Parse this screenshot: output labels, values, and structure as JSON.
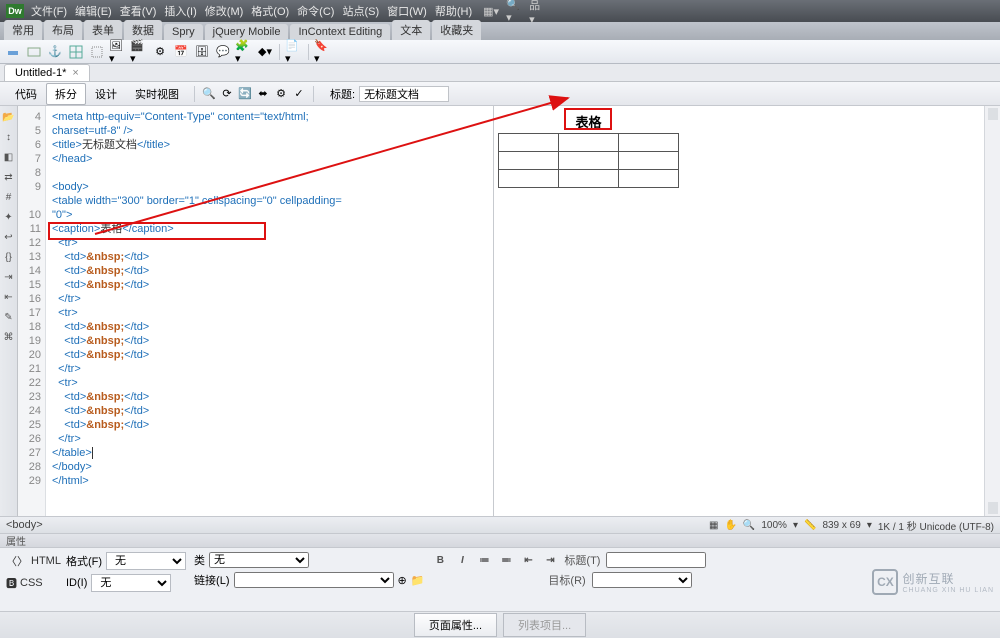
{
  "titlebar": {
    "logo": "Dw",
    "menus": [
      "文件(F)",
      "编辑(E)",
      "查看(V)",
      "插入(I)",
      "修改(M)",
      "格式(O)",
      "命令(C)",
      "站点(S)",
      "窗口(W)",
      "帮助(H)"
    ]
  },
  "category_tabs": [
    "常用",
    "布局",
    "表单",
    "数据",
    "Spry",
    "jQuery Mobile",
    "InContext Editing",
    "文本",
    "收藏夹"
  ],
  "doc_tab": {
    "name": "Untitled-1*"
  },
  "viewbar": {
    "buttons": [
      "代码",
      "拆分",
      "设计",
      "实时视图"
    ],
    "active": "拆分",
    "title_label": "标题:",
    "title_value": "无标题文档"
  },
  "gutter_lines": [
    "4",
    "5",
    "6",
    "7",
    "8",
    "9",
    "",
    "10",
    "11",
    "12",
    "13",
    "14",
    "15",
    "16",
    "17",
    "18",
    "19",
    "20",
    "21",
    "22",
    "23",
    "24",
    "25",
    "26",
    "27",
    "28",
    "29"
  ],
  "code_lines": [
    {
      "html": "<span class='tag'>&lt;meta</span> <span class='attr'>http-equiv=</span><span class='val'>\"Content-Type\"</span> <span class='attr'>content=</span><span class='val'>\"text/html;</span>"
    },
    {
      "html": "<span class='val'>charset=utf-8\"</span> <span class='tag'>/&gt;</span>"
    },
    {
      "html": "<span class='tag'>&lt;title&gt;</span><span class='text'>无标题文档</span><span class='tag'>&lt;/title&gt;</span>"
    },
    {
      "html": "<span class='tag'>&lt;/head&gt;</span>"
    },
    {
      "html": "&nbsp;"
    },
    {
      "html": "<span class='tag'>&lt;body&gt;</span>"
    },
    {
      "html": "<span class='tag'>&lt;table</span> <span class='attr'>width=</span><span class='val'>\"300\"</span> <span class='attr'>border=</span><span class='val'>\"1\"</span> <span class='attr'>cellspacing=</span><span class='val'>\"0\"</span> <span class='attr'>cellpadding=</span>"
    },
    {
      "html": "<span class='val'>\"0\"</span><span class='tag'>&gt;</span>"
    },
    {
      "html": "<span class='tag'>&lt;caption&gt;</span><span class='text'>表格</span><span class='tag'>&lt;/caption&gt;</span>"
    },
    {
      "html": "&nbsp;&nbsp;<span class='tag'>&lt;tr&gt;</span>"
    },
    {
      "html": "&nbsp;&nbsp;&nbsp;&nbsp;<span class='tag'>&lt;td&gt;</span><span class='ent'>&amp;nbsp;</span><span class='tag'>&lt;/td&gt;</span>"
    },
    {
      "html": "&nbsp;&nbsp;&nbsp;&nbsp;<span class='tag'>&lt;td&gt;</span><span class='ent'>&amp;nbsp;</span><span class='tag'>&lt;/td&gt;</span>"
    },
    {
      "html": "&nbsp;&nbsp;&nbsp;&nbsp;<span class='tag'>&lt;td&gt;</span><span class='ent'>&amp;nbsp;</span><span class='tag'>&lt;/td&gt;</span>"
    },
    {
      "html": "&nbsp;&nbsp;<span class='tag'>&lt;/tr&gt;</span>"
    },
    {
      "html": "&nbsp;&nbsp;<span class='tag'>&lt;tr&gt;</span>"
    },
    {
      "html": "&nbsp;&nbsp;&nbsp;&nbsp;<span class='tag'>&lt;td&gt;</span><span class='ent'>&amp;nbsp;</span><span class='tag'>&lt;/td&gt;</span>"
    },
    {
      "html": "&nbsp;&nbsp;&nbsp;&nbsp;<span class='tag'>&lt;td&gt;</span><span class='ent'>&amp;nbsp;</span><span class='tag'>&lt;/td&gt;</span>"
    },
    {
      "html": "&nbsp;&nbsp;&nbsp;&nbsp;<span class='tag'>&lt;td&gt;</span><span class='ent'>&amp;nbsp;</span><span class='tag'>&lt;/td&gt;</span>"
    },
    {
      "html": "&nbsp;&nbsp;<span class='tag'>&lt;/tr&gt;</span>"
    },
    {
      "html": "&nbsp;&nbsp;<span class='tag'>&lt;tr&gt;</span>"
    },
    {
      "html": "&nbsp;&nbsp;&nbsp;&nbsp;<span class='tag'>&lt;td&gt;</span><span class='ent'>&amp;nbsp;</span><span class='tag'>&lt;/td&gt;</span>"
    },
    {
      "html": "&nbsp;&nbsp;&nbsp;&nbsp;<span class='tag'>&lt;td&gt;</span><span class='ent'>&amp;nbsp;</span><span class='tag'>&lt;/td&gt;</span>"
    },
    {
      "html": "&nbsp;&nbsp;&nbsp;&nbsp;<span class='tag'>&lt;td&gt;</span><span class='ent'>&amp;nbsp;</span><span class='tag'>&lt;/td&gt;</span>"
    },
    {
      "html": "&nbsp;&nbsp;<span class='tag'>&lt;/tr&gt;</span>"
    },
    {
      "html": "<span class='tag'>&lt;/table&gt;</span><span style='border-left:1px solid #333'></span>"
    },
    {
      "html": "<span class='tag'>&lt;/body&gt;</span>"
    },
    {
      "html": "<span class='tag'>&lt;/html&gt;</span>"
    },
    {
      "html": "&nbsp;"
    }
  ],
  "preview": {
    "caption": "表格",
    "rows": 3,
    "cols": 3
  },
  "tagpath": {
    "left": "<body>",
    "zoom": "100%",
    "dims": "839 x 69",
    "status": "1K / 1 秒 Unicode (UTF-8)"
  },
  "prop_header": "属性",
  "props": {
    "html_tab": "HTML",
    "css_tab": "CSS",
    "format_label": "格式(F)",
    "format_value": "无",
    "id_label": "ID(I)",
    "id_value": "无",
    "class_label": "类",
    "class_value": "无",
    "link_label": "链接(L)",
    "link_value": "",
    "bold": "B",
    "italic": "I",
    "title_label": "标题(T)",
    "target_label": "目标(R)"
  },
  "bottom": {
    "page_props": "页面属性...",
    "list_items": "列表项目..."
  },
  "watermark": {
    "text": "创新互联",
    "sub": "CHUANG XIN HU LIAN",
    "icon": "CX"
  }
}
